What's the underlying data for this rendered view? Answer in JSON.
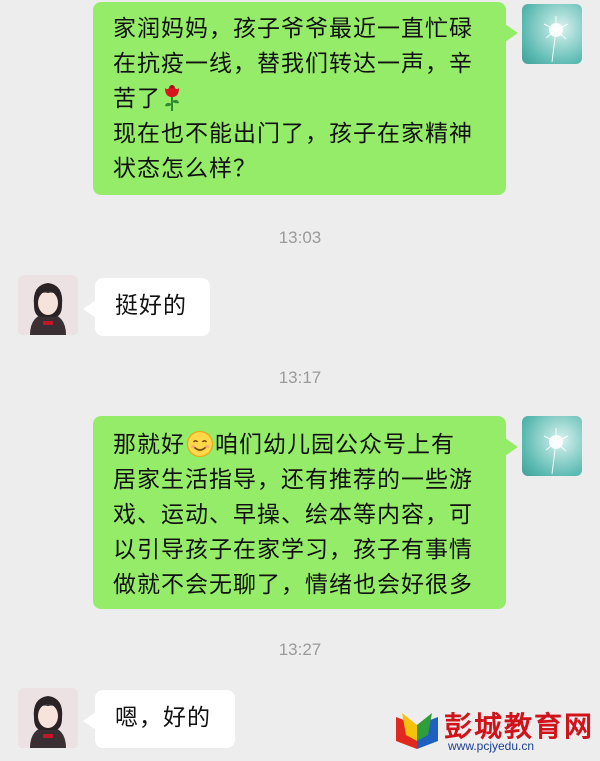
{
  "messages": {
    "m1": {
      "lines": [
        "家润妈妈，孩子爷爷最近一直忙碌",
        "在抗疫一线，替我们转达一声，辛",
        "苦了",
        "现在也不能出门了，孩子在家精神",
        "状态怎么样？"
      ],
      "emoji": "rose-icon"
    },
    "t1": "13:03",
    "m2": {
      "text": "挺好的"
    },
    "t2": "13:17",
    "m3": {
      "line1_before": "那就好",
      "line1_after": "咱们幼儿园公众号上有",
      "lines": [
        "居家生活指导，还有推荐的一些游",
        "戏、运动、早操、绘本等内容，可",
        "以引导孩子在家学习，孩子有事情",
        "做就不会无聊了，情绪也会好很多"
      ],
      "emoji": "smile-icon"
    },
    "t3": "13:27",
    "m4": {
      "text": "嗯，好的"
    }
  },
  "watermark": {
    "title": "彭城教育网",
    "url": "www.pcjyedu.cn"
  },
  "colors": {
    "outgoing_bubble": "#95ec69",
    "incoming_bubble": "#ffffff",
    "background": "#ededed",
    "timestamp": "#9a9a9a",
    "watermark_red": "#d0121b"
  }
}
